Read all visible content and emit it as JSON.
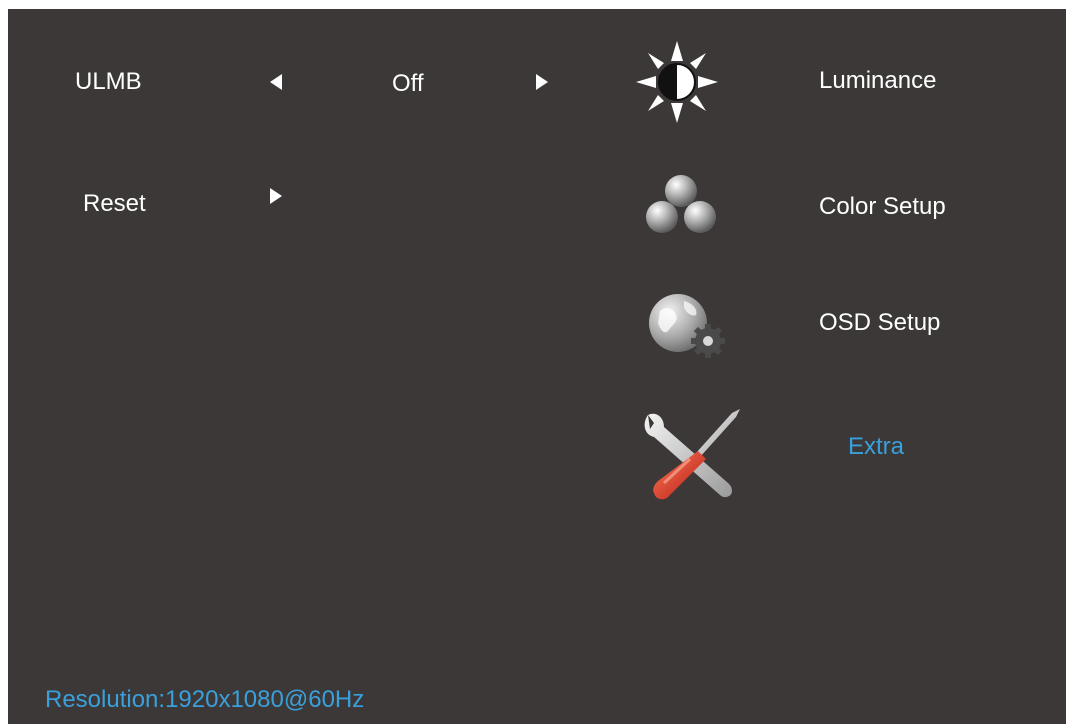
{
  "settings": {
    "ulmb_label": "ULMB",
    "ulmb_value": "Off",
    "reset_label": "Reset"
  },
  "menu": {
    "items": [
      {
        "label": "Luminance",
        "icon": "brightness-icon",
        "active": false
      },
      {
        "label": "Color Setup",
        "icon": "color-spheres-icon",
        "active": false
      },
      {
        "label": "OSD Setup",
        "icon": "globe-gear-icon",
        "active": false
      },
      {
        "label": "Extra",
        "icon": "tools-icon",
        "active": true
      }
    ]
  },
  "status": {
    "resolution": "Resolution:1920x1080@60Hz"
  },
  "colors": {
    "background": "#3c3837",
    "text": "#ffffff",
    "accent": "#3aa0dc"
  }
}
